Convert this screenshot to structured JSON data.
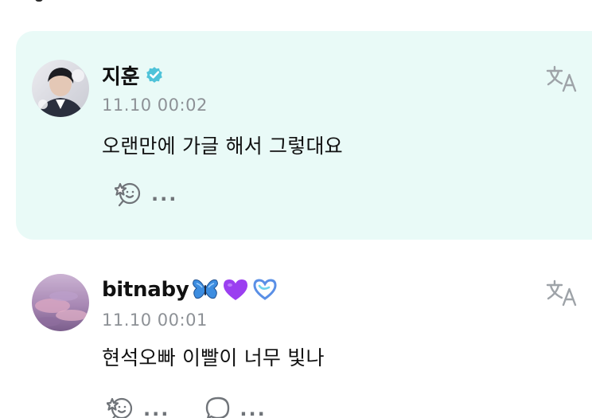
{
  "comments": [
    {
      "username": "지훈",
      "verified": true,
      "timestamp": "11.10 00:02",
      "text": "오랜만에 가글 해서 그렇대요",
      "highlighted": true,
      "reaction_count": "...",
      "icons": [
        "verified-badge-icon",
        "translate-icon",
        "reaction-icon"
      ],
      "colors": {
        "background": "#e9faf7",
        "badge": "#4fc3d9"
      }
    },
    {
      "username": "bitnaby",
      "timestamp": "11.10 00:01",
      "text": "현석오빠 이빨이 너무 빛나",
      "highlighted": false,
      "reaction_count": "...",
      "reply_count": "...",
      "name_emojis": [
        "butterfly-emoji",
        "purple-heart-emoji",
        "blue-heart-emoji"
      ],
      "icons": [
        "translate-icon",
        "reaction-icon",
        "reply-icon"
      ]
    }
  ]
}
